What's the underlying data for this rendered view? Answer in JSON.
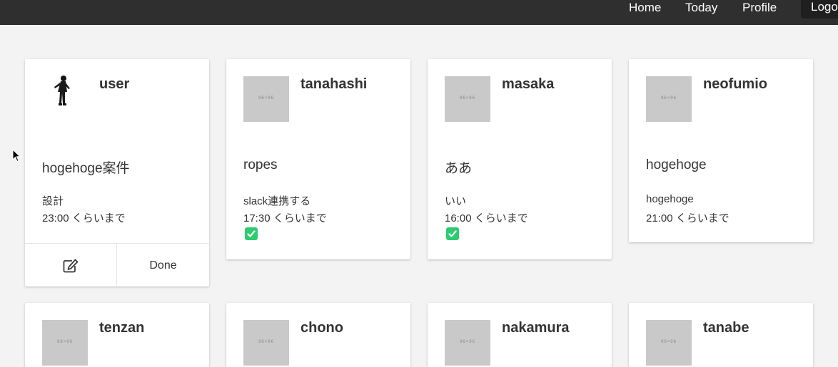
{
  "nav": {
    "home": "Home",
    "today": "Today",
    "profile": "Profile",
    "logout": "Logout"
  },
  "thumb_placeholder": "96×96",
  "cards": [
    {
      "user": "user",
      "project": "hogehoge案件",
      "task": "設計",
      "until": "23:00 くらいまで",
      "done": false
    },
    {
      "user": "tanahashi",
      "project": "ropes",
      "task": "slack連携する",
      "until": "17:30 くらいまで",
      "done": true
    },
    {
      "user": "masaka",
      "project": "ああ",
      "task": "いい",
      "until": "16:00 くらいまで",
      "done": true
    },
    {
      "user": "neofumio",
      "project": "hogehoge",
      "task": "hogehoge",
      "until": "21:00 くらいまで",
      "done": false
    },
    {
      "user": "tenzan"
    },
    {
      "user": "chono"
    },
    {
      "user": "nakamura"
    },
    {
      "user": "tanabe"
    }
  ],
  "actions": {
    "edit_icon": "edit-icon",
    "done_label": "Done"
  },
  "colors": {
    "topbar": "#2f2f2f",
    "background": "#f3f3f3",
    "check": "#2ecc71"
  }
}
